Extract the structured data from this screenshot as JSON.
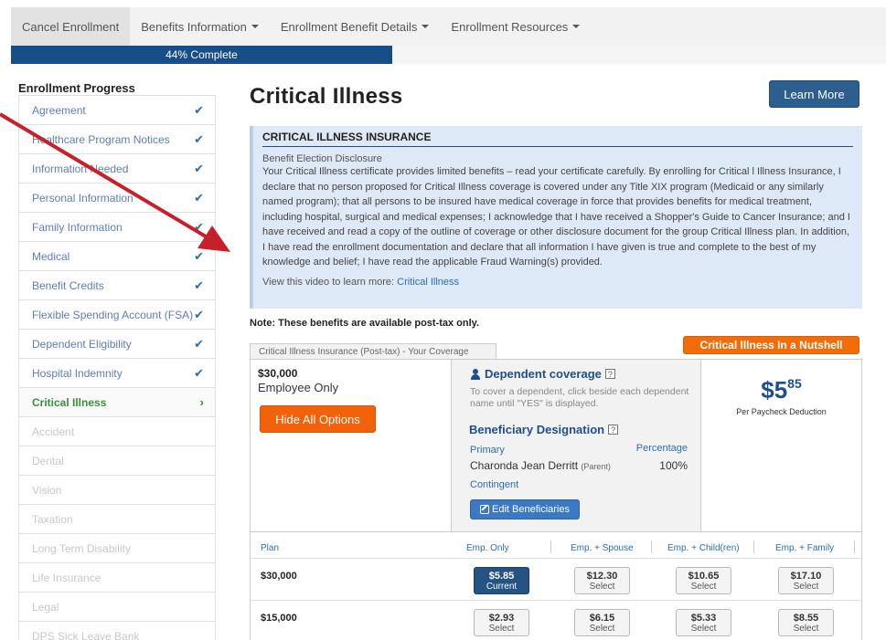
{
  "nav": {
    "items": [
      {
        "label": "Cancel Enrollment",
        "dropdown": false
      },
      {
        "label": "Benefits Information",
        "dropdown": true
      },
      {
        "label": "Enrollment Benefit Details",
        "dropdown": true
      },
      {
        "label": "Enrollment Resources",
        "dropdown": true
      }
    ]
  },
  "progress": {
    "label": "44% Complete",
    "value": 0.44
  },
  "sidebar": {
    "title": "Enrollment Progress",
    "items": [
      {
        "label": "Agreement",
        "state": "done"
      },
      {
        "label": "Healthcare Program Notices",
        "state": "done"
      },
      {
        "label": "Information Needed",
        "state": "done"
      },
      {
        "label": "Personal Information",
        "state": "done"
      },
      {
        "label": "Family Information",
        "state": "done"
      },
      {
        "label": "Medical",
        "state": "done"
      },
      {
        "label": "Benefit Credits",
        "state": "done"
      },
      {
        "label": "Flexible Spending Account (FSA)",
        "state": "done"
      },
      {
        "label": "Dependent Eligibility",
        "state": "done"
      },
      {
        "label": "Hospital Indemnity",
        "state": "done"
      },
      {
        "label": "Critical Illness",
        "state": "current"
      },
      {
        "label": "Accident",
        "state": "pending"
      },
      {
        "label": "Dental",
        "state": "pending"
      },
      {
        "label": "Vision",
        "state": "pending"
      },
      {
        "label": "Taxation",
        "state": "pending"
      },
      {
        "label": "Long Term Disability",
        "state": "pending"
      },
      {
        "label": "Life Insurance",
        "state": "pending"
      },
      {
        "label": "Legal",
        "state": "pending"
      },
      {
        "label": "DPS Sick Leave Bank",
        "state": "pending"
      }
    ]
  },
  "main": {
    "title": "Critical Illness",
    "learn_more": "Learn More",
    "disclosure": {
      "heading": "CRITICAL ILLNESS INSURANCE",
      "subheading": "Benefit Election Disclosure",
      "body": "Your Critical Illness certificate provides limited benefits – read your certificate carefully. By enrolling for Critical l Illness Insurance, I declare that no person proposed for Critical Illness coverage is covered under any Title XIX program (Medicaid or any similarly named program); that all persons to be insured have medical coverage in force that provides benefits for medical treatment, including hospital, surgical and medical expenses; I acknowledge that I have received a Shopper's Guide to Cancer Insurance; and I have received and read a copy of the outline of coverage or other disclosure document for the group Critical Illness plan. In addition, I have read the enrollment documentation and declare that all information I have given is true and complete to the best of my knowledge and belief; I have read the applicable Fraud Warning(s) provided.",
      "video_prefix": "View this video to learn more: ",
      "video_link": "Critical Illness"
    },
    "note": "Note: These benefits are available post-tax only.",
    "coverage_tab": "Critical Illness Insurance (Post-tax) - Your Coverage",
    "nutshell": "Critical Illness In a Nutshell",
    "coverage": {
      "amount": "$30,000",
      "tier": "Employee Only",
      "hide_options": "Hide All Options",
      "dependent_title": "Dependent coverage",
      "help_mark": "?",
      "dependent_text": "To cover a dependent, click beside each dependent name until \"YES\" is displayed.",
      "beneficiary_title": "Beneficiary Designation",
      "primary_label": "Primary",
      "percentage_label": "Percentage",
      "beneficiary_name": "Charonda Jean Derritt",
      "beneficiary_relation": "(Parent)",
      "beneficiary_pct": "100%",
      "contingent_label": "Contingent",
      "edit_beneficiaries": "Edit Beneficiaries",
      "price_dollar": "$5",
      "price_cents": "85",
      "price_caption": "Per Paycheck Deduction"
    },
    "plans": {
      "headers": [
        "Plan",
        "Emp. Only",
        "Emp. + Spouse",
        "Emp. + Child(ren)",
        "Emp. + Family"
      ],
      "rows": [
        {
          "plan": "$30,000",
          "options": [
            {
              "price": "$5.85",
              "action": "Current",
              "current": true
            },
            {
              "price": "$12.30",
              "action": "Select",
              "current": false
            },
            {
              "price": "$10.65",
              "action": "Select",
              "current": false
            },
            {
              "price": "$17.10",
              "action": "Select",
              "current": false
            }
          ]
        },
        {
          "plan": "$15,000",
          "options": [
            {
              "price": "$2.93",
              "action": "Select",
              "current": false
            },
            {
              "price": "$6.15",
              "action": "Select",
              "current": false
            },
            {
              "price": "$5.33",
              "action": "Select",
              "current": false
            },
            {
              "price": "$8.55",
              "action": "Select",
              "current": false
            }
          ]
        }
      ]
    }
  },
  "colors": {
    "primary_blue": "#174e87",
    "accent_orange": "#f26d0a",
    "check_blue": "#2f6ea8",
    "current_green": "#3a8f3a",
    "arrow_red": "#c8202a"
  }
}
